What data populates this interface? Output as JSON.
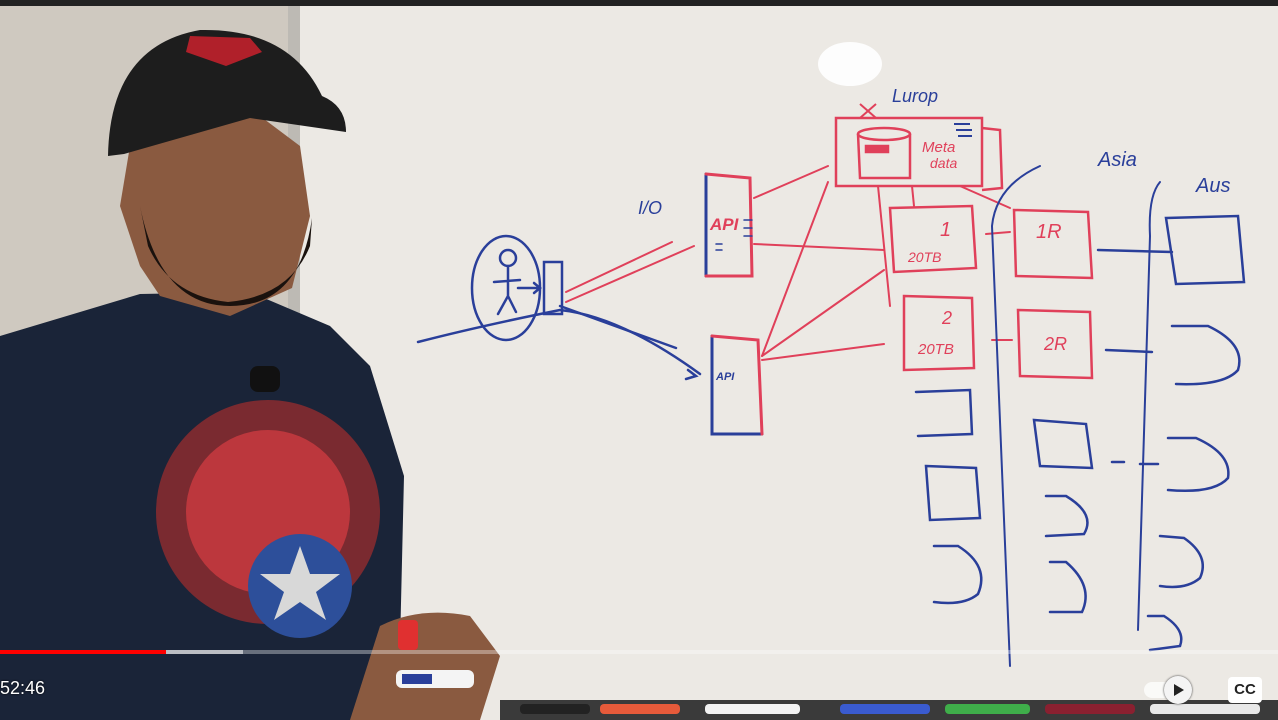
{
  "video": {
    "time_display": "52:46",
    "progress_fraction": 0.13,
    "buffer_fraction": 0.19
  },
  "controls": {
    "cc_label": "CC",
    "autoplay_on": true
  },
  "whiteboard": {
    "region_europe": "Lurop",
    "region_asia": "Asia",
    "region_aus": "Aus",
    "io_label": "I/O",
    "api_top": "API",
    "api_bottom": "API",
    "metadata_line1": "Meta",
    "metadata_line2": "data",
    "node1_id": "1",
    "node1_size": "20TB",
    "node2_id": "2",
    "node2_size": "20TB",
    "replica1": "1R",
    "replica2": "2R"
  },
  "colors": {
    "progress_red": "#ff0000",
    "marker_red": "#e0405a",
    "marker_blue": "#2a3f9a",
    "tshirt": "#1a2438"
  }
}
